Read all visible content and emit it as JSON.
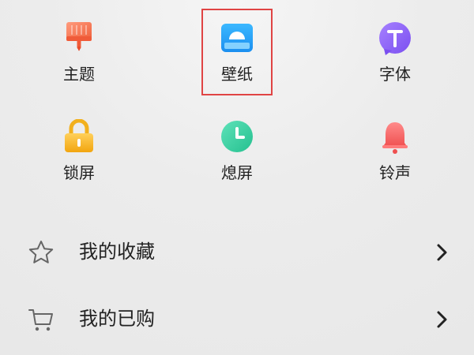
{
  "tiles": [
    {
      "label": "主题",
      "icon": "paintbrush-icon"
    },
    {
      "label": "壁纸",
      "icon": "wallpaper-icon"
    },
    {
      "label": "字体",
      "icon": "font-icon"
    },
    {
      "label": "锁屏",
      "icon": "lock-icon"
    },
    {
      "label": "熄屏",
      "icon": "clock-icon"
    },
    {
      "label": "铃声",
      "icon": "bell-icon"
    }
  ],
  "list": [
    {
      "label": "我的收藏",
      "icon": "star-icon"
    },
    {
      "label": "我的已购",
      "icon": "cart-icon"
    }
  ],
  "colors": {
    "accent_red": "#e04444",
    "wallpaper_blue": "#2fa8f5",
    "font_purple": "#8d63f2",
    "lock_yellow": "#f7b21a",
    "clock_green": "#35cfa0",
    "bell_red": "#f36b6b"
  }
}
